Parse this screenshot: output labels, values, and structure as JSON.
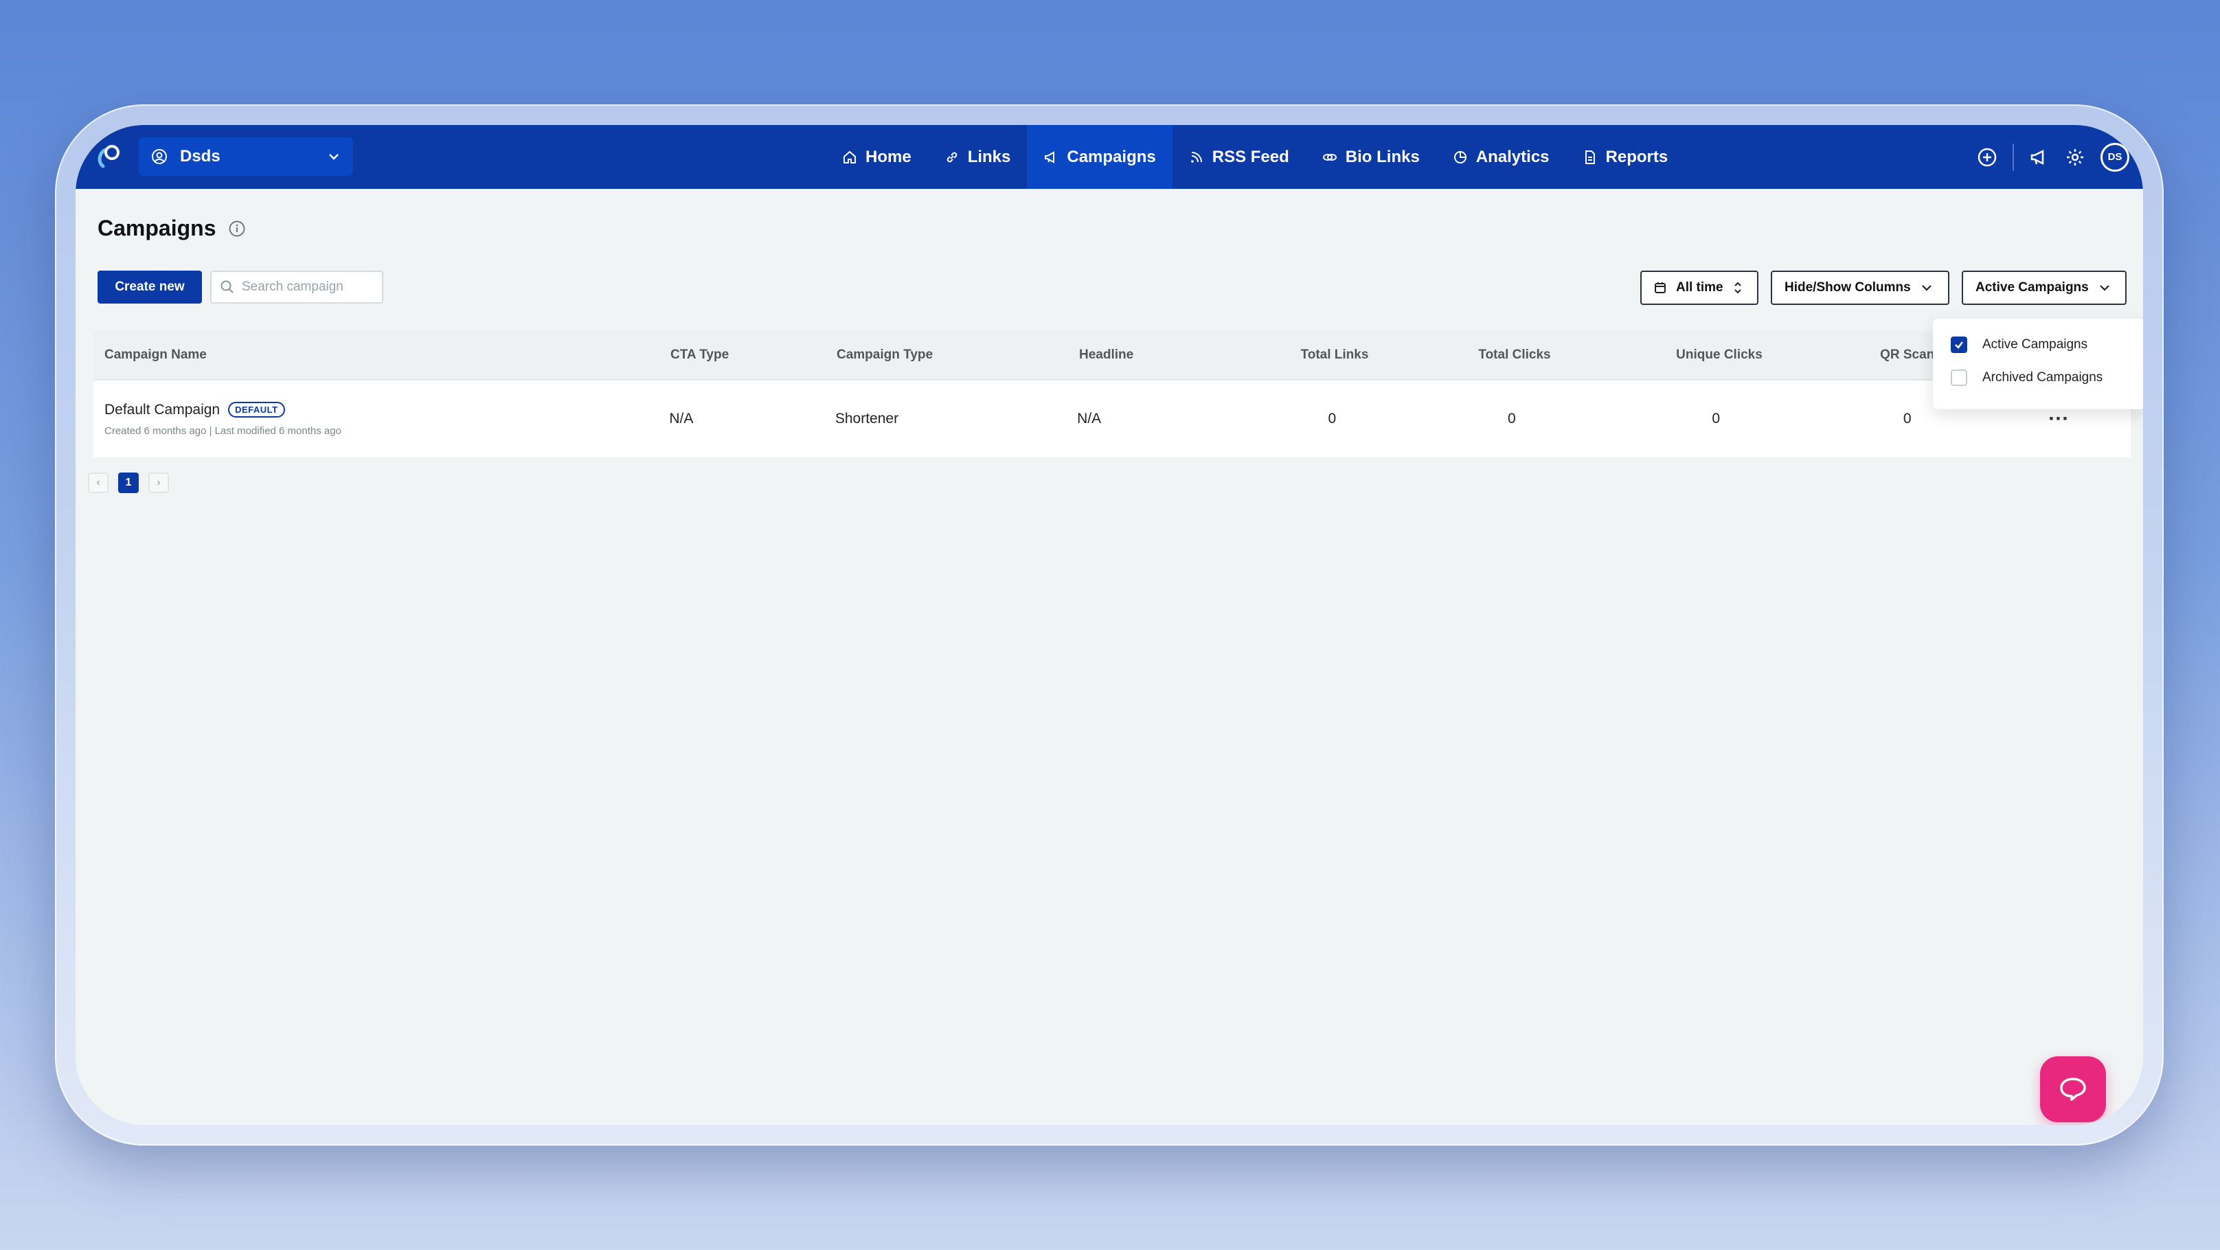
{
  "workspace": {
    "name": "Dsds"
  },
  "nav": {
    "items": [
      {
        "label": "Home",
        "icon": "home-icon"
      },
      {
        "label": "Links",
        "icon": "link-icon"
      },
      {
        "label": "Campaigns",
        "icon": "megaphone-icon",
        "active": true
      },
      {
        "label": "RSS Feed",
        "icon": "rss-icon"
      },
      {
        "label": "Bio Links",
        "icon": "bio-links-icon"
      },
      {
        "label": "Analytics",
        "icon": "analytics-icon"
      },
      {
        "label": "Reports",
        "icon": "report-icon"
      }
    ],
    "avatar_initials": "DS"
  },
  "page": {
    "title": "Campaigns",
    "create_label": "Create new",
    "search_placeholder": "Search campaign",
    "date_filter": "All time",
    "columns_button": "Hide/Show Columns",
    "status_filter": "Active Campaigns"
  },
  "table": {
    "columns": [
      "Campaign Name",
      "CTA Type",
      "Campaign Type",
      "Headline",
      "Total Links",
      "Total Clicks",
      "Unique Clicks",
      "QR Scans"
    ],
    "rows": [
      {
        "name": "Default Campaign",
        "badge": "DEFAULT",
        "meta": "Created 6 months ago | Last modified 6 months ago",
        "cta_type": "N/A",
        "campaign_type": "Shortener",
        "headline": "N/A",
        "total_links": "0",
        "total_clicks": "0",
        "unique_clicks": "0",
        "qr_scans": "0",
        "more": "···"
      }
    ]
  },
  "pagination": {
    "prev": "‹",
    "current": "1",
    "next": "›"
  },
  "dropdown": {
    "options": [
      {
        "label": "Active Campaigns",
        "checked": true
      },
      {
        "label": "Archived Campaigns",
        "checked": false
      }
    ]
  },
  "colors": {
    "primary": "#0b3aa6",
    "accent_pink": "#e8277e",
    "background": "#f0f4f4"
  }
}
